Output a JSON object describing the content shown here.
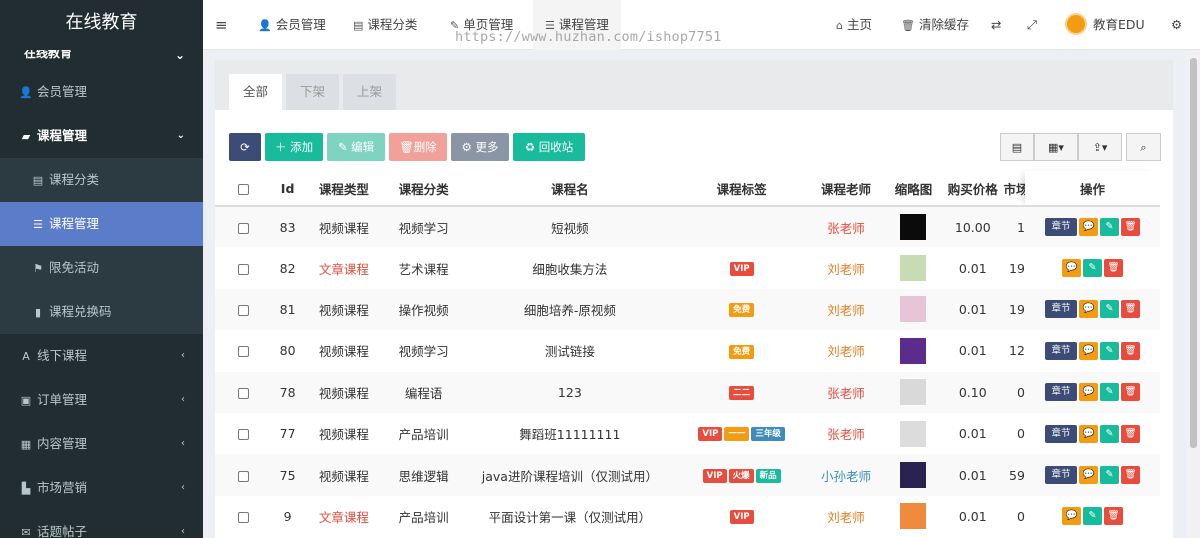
{
  "brand": "在线教育",
  "sidebar": {
    "top_partial": "在线教育",
    "items": [
      {
        "label": "会员管理",
        "icon": "user-icon",
        "type": "item"
      },
      {
        "label": "课程管理",
        "icon": "book-icon",
        "type": "open"
      },
      {
        "label": "课程分类",
        "icon": "category-icon",
        "type": "sub"
      },
      {
        "label": "课程管理",
        "icon": "list-icon",
        "type": "active"
      },
      {
        "label": "限免活动",
        "icon": "flag-icon",
        "type": "sub"
      },
      {
        "label": "课程兑换码",
        "icon": "bookmark-icon",
        "type": "sub"
      },
      {
        "label": "线下课程",
        "icon": "font-icon",
        "type": "collapsed"
      },
      {
        "label": "订单管理",
        "icon": "copy-icon",
        "type": "collapsed"
      },
      {
        "label": "内容管理",
        "icon": "content-icon",
        "type": "collapsed"
      },
      {
        "label": "市场营销",
        "icon": "bar-chart-icon",
        "type": "collapsed"
      },
      {
        "label": "话题帖子",
        "icon": "topic-icon",
        "type": "collapsed"
      }
    ]
  },
  "topbar": {
    "tabs": [
      {
        "label": "会员管理",
        "icon": "user-icon"
      },
      {
        "label": "课程分类",
        "icon": "category-icon"
      },
      {
        "label": "单页管理",
        "icon": "edit-icon"
      },
      {
        "label": "课程管理",
        "icon": "list-icon"
      }
    ],
    "home": "主页",
    "clear_cache": "清除缓存",
    "username": "教育EDU",
    "watermark": "https://www.huzhan.com/ishop7751"
  },
  "filter_tabs": [
    "全部",
    "下架",
    "上架"
  ],
  "toolbar": {
    "add": "添加",
    "edit": "编辑",
    "delete": "删除",
    "more": "更多",
    "recycle": "回收站"
  },
  "colors": {
    "sidebar": "#222d32",
    "active": "#5b7cc9",
    "add": "#18bc9c",
    "edit": "#7fd3c1",
    "delete": "#f1a09a",
    "more": "#8a95a5",
    "recycle": "#18bc9c",
    "chapter": "#3d4b77",
    "yellow": "#f39c12",
    "green": "#18bc9c",
    "red": "#e74c3c"
  },
  "table": {
    "headers": [
      "Id",
      "课程类型",
      "课程分类",
      "课程名",
      "课程标签",
      "课程老师",
      "缩略图",
      "购买价格",
      "市场",
      "操作"
    ],
    "ops": {
      "chapter": "章节"
    },
    "rows": [
      {
        "id": "83",
        "type": "视频课程",
        "type_red": false,
        "cat": "视频学习",
        "name": "短视频",
        "tags": [],
        "teacher": "张老师",
        "tcolor": "red",
        "thumb": "#0b0b0b",
        "price": "10.00",
        "market": "1",
        "chapter": true
      },
      {
        "id": "82",
        "type": "文章课程",
        "type_red": true,
        "cat": "艺术课程",
        "name": "细胞收集方法",
        "tags": [
          {
            "t": "VIP",
            "c": "#e74c3c"
          }
        ],
        "teacher": "刘老师",
        "tcolor": "orange",
        "thumb": "#c8dcb4",
        "price": "0.01",
        "market": "19",
        "chapter": false
      },
      {
        "id": "81",
        "type": "视频课程",
        "type_red": false,
        "cat": "操作视频",
        "name": "细胞培养-原视频",
        "tags": [
          {
            "t": "免费",
            "c": "#f39c12"
          }
        ],
        "teacher": "刘老师",
        "tcolor": "orange",
        "thumb": "#e6c6d6",
        "price": "0.01",
        "market": "19",
        "chapter": true
      },
      {
        "id": "80",
        "type": "视频课程",
        "type_red": false,
        "cat": "视频学习",
        "name": "测试链接",
        "tags": [
          {
            "t": "免费",
            "c": "#f39c12"
          }
        ],
        "teacher": "刘老师",
        "tcolor": "orange",
        "thumb": "#5a2d8c",
        "price": "0.01",
        "market": "12",
        "chapter": true
      },
      {
        "id": "78",
        "type": "视频课程",
        "type_red": false,
        "cat": "编程语",
        "name": "123",
        "tags": [
          {
            "t": "二二",
            "c": "#e74c3c"
          }
        ],
        "teacher": "张老师",
        "tcolor": "red",
        "thumb": "#d9d9d9",
        "price": "0.10",
        "market": "0",
        "chapter": true
      },
      {
        "id": "77",
        "type": "视频课程",
        "type_red": false,
        "cat": "产品培训",
        "name": "舞蹈班11111111",
        "tags": [
          {
            "t": "VIP",
            "c": "#e74c3c"
          },
          {
            "t": "一一",
            "c": "#f39c12"
          },
          {
            "t": "三年级",
            "c": "#3c8dbc"
          }
        ],
        "teacher": "张老师",
        "tcolor": "red",
        "thumb": "#dcdcdc",
        "price": "0.01",
        "market": "0",
        "chapter": true
      },
      {
        "id": "75",
        "type": "视频课程",
        "type_red": false,
        "cat": "思维逻辑",
        "name": "java进阶课程培训（仅测试用）",
        "tags": [
          {
            "t": "VIP",
            "c": "#e74c3c"
          },
          {
            "t": "火爆",
            "c": "#e74c3c"
          },
          {
            "t": "新品",
            "c": "#18bc9c"
          }
        ],
        "teacher": "小孙老师",
        "tcolor": "blue",
        "thumb": "#2a2250",
        "price": "0.01",
        "market": "59",
        "chapter": true
      },
      {
        "id": "9",
        "type": "文章课程",
        "type_red": true,
        "cat": "产品培训",
        "name": "平面设计第一课（仅测试用）",
        "tags": [
          {
            "t": "VIP",
            "c": "#e74c3c"
          }
        ],
        "teacher": "刘老师",
        "tcolor": "orange",
        "thumb": "#f08a3c",
        "price": "0.01",
        "market": "0",
        "chapter": false
      }
    ]
  }
}
